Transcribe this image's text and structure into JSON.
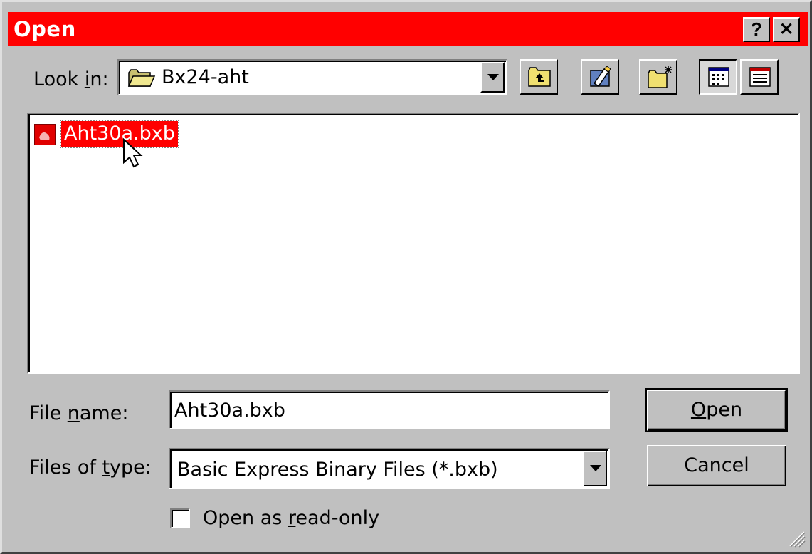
{
  "window": {
    "title": "Open",
    "help_button": "?",
    "close_button": "✕"
  },
  "look_in": {
    "label_pre": "Look ",
    "label_key": "i",
    "label_post": "n:",
    "value": "Bx24-aht"
  },
  "toolbar": {
    "icons": [
      "up-one-level-icon",
      "go-to-desktop-icon",
      "create-new-folder-icon",
      "list-view-icon",
      "details-view-icon"
    ]
  },
  "files": [
    {
      "name": "Aht30a.bxb",
      "selected": true
    }
  ],
  "file_name": {
    "label_pre": "File ",
    "label_key": "n",
    "label_post": "ame:",
    "value": "Aht30a.bxb"
  },
  "files_of_type": {
    "label_pre": "Files of ",
    "label_key": "t",
    "label_post": "ype:",
    "value": "Basic Express Binary Files (*.bxb)"
  },
  "buttons": {
    "open_key": "O",
    "open_rest": "pen",
    "cancel": "Cancel"
  },
  "read_only": {
    "label_pre": "Open as ",
    "label_key": "r",
    "label_post": "ead-only",
    "checked": false
  },
  "colors": {
    "titlebar": "#ff0000",
    "selection": "#ff0000",
    "face": "#c0c0c0"
  }
}
